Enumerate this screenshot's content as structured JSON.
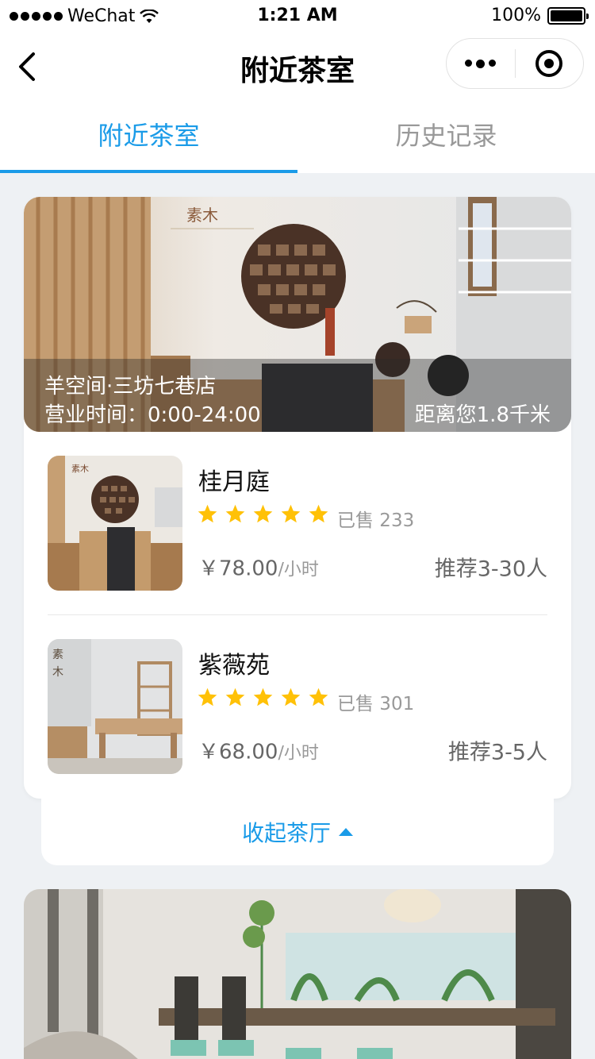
{
  "status_bar": {
    "carrier": "WeChat",
    "time": "1:21 AM",
    "battery": "100%",
    "battery_level": 1.0
  },
  "nav": {
    "title": "附近茶室",
    "back_icon": "chevron-left-icon",
    "more_icon": "more-dots-icon",
    "close_icon": "target-icon"
  },
  "tabs": [
    {
      "label": "附近茶室",
      "active": true
    },
    {
      "label": "历史记录",
      "active": false
    }
  ],
  "store": {
    "name": "羊空间·三坊七巷店",
    "hours": "营业时间：0:00-24:00",
    "distance": "距离您1.8千米",
    "banner_logo": "素木",
    "rooms": [
      {
        "name": "桂月庭",
        "rating": 5,
        "sold": "已售 233",
        "price": "￥78.00",
        "unit": "/小时",
        "recommend": "推荐3-30人"
      },
      {
        "name": "紫薇苑",
        "rating": 5,
        "sold": "已售 301",
        "price": "￥68.00",
        "unit": "/小时",
        "recommend": "推荐3-5人"
      }
    ]
  },
  "collapse": {
    "label": "收起茶厅"
  },
  "colors": {
    "accent": "#1a9be8",
    "star": "#ffc107",
    "background": "#eef1f4"
  }
}
